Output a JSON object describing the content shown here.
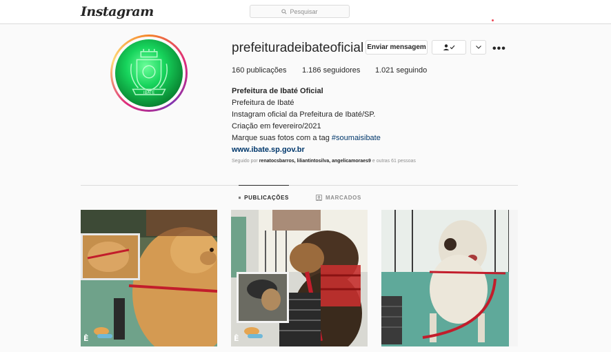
{
  "header": {
    "logo_text": "Instagram",
    "search_placeholder": "Pesquisar"
  },
  "profile": {
    "username": "prefeituradeibateoficial",
    "buttons": {
      "message": "Enviar mensagem",
      "more": "•••"
    },
    "stats": {
      "posts": "160 publicações",
      "followers": "1.186 seguidores",
      "following": "1.021 seguindo"
    },
    "bio": {
      "name": "Prefeitura de Ibaté Oficial",
      "line1": "Prefeitura de Ibaté",
      "line2": "Instagram oficial da Prefeitura de Ibaté/SP.",
      "line3": "Criação em fevereiro/2021",
      "line4_prefix": "Marque suas fotos com a tag ",
      "line4_tag": "#soumaisibate",
      "website": "www.ibate.sp.gov.br"
    },
    "followed_by": {
      "prefix": "Seguido por ",
      "users": "renatocsbarros, liliantintosilva, angelicamoraes9",
      "suffix": " e outras 61 pessoas"
    }
  },
  "tabs": {
    "posts": "PUBLICAÇÕES",
    "tagged": "MARCADOS"
  },
  "colors": {
    "link": "#00376b",
    "muted": "#8e8e8e",
    "border": "#dbdbdb",
    "avatar_green": "#17d45c"
  }
}
